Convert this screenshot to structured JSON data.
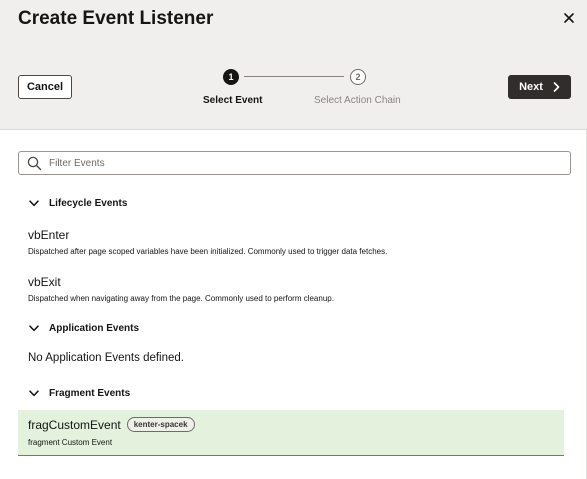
{
  "dialog": {
    "title": "Create Event Listener"
  },
  "toolbar": {
    "cancel_label": "Cancel",
    "next_label": "Next",
    "steps": [
      {
        "number": "1",
        "label": "Select Event",
        "state": "active"
      },
      {
        "number": "2",
        "label": "Select Action Chain",
        "state": "inactive"
      }
    ]
  },
  "search": {
    "placeholder": "Filter Events",
    "value": ""
  },
  "sections": [
    {
      "title": "Lifecycle Events",
      "events": [
        {
          "name": "vbEnter",
          "description": "Dispatched after page scoped variables have been initialized. Commonly used to trigger data fetches."
        },
        {
          "name": "vbExit",
          "description": "Dispatched when navigating away from the page. Commonly used to perform cleanup."
        }
      ]
    },
    {
      "title": "Application Events",
      "empty_text": "No Application Events defined."
    },
    {
      "title": "Fragment Events",
      "events": [
        {
          "name": "fragCustomEvent",
          "badge": "kenter-spacek",
          "description": "fragment Custom Event",
          "selected": true
        }
      ]
    }
  ],
  "colors": {
    "header_bg": "#f1efed",
    "primary_button": "#312d2a",
    "selected_row_bg": "#e3f1dd",
    "selected_row_border": "#5d8c4a"
  },
  "icons": {
    "close": "close-icon",
    "search": "search-icon",
    "next": "chevron-right-icon",
    "section_toggle": "chevron-down-icon"
  }
}
